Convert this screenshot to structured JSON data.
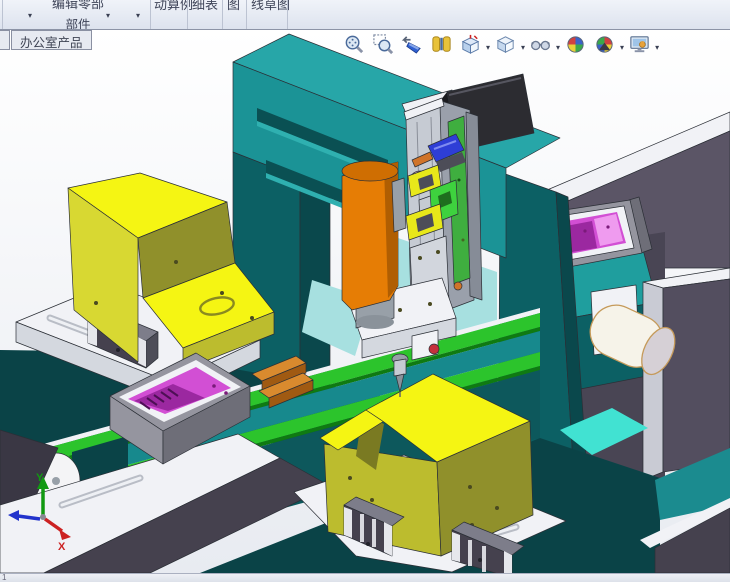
{
  "window": {
    "status_bar_left": "1"
  },
  "command_manager": {
    "component_button": {
      "top_line_clipped": "编辑零部",
      "bottom_line": "部件"
    },
    "clipped_labels": [
      "动算例",
      "细表",
      "图",
      "线草图"
    ],
    "tabs": {
      "active": "办公室产品"
    }
  },
  "heads_up_toolbar": {
    "tools": [
      {
        "name": "zoom-to-fit"
      },
      {
        "name": "zoom-to-area"
      },
      {
        "name": "previous-view"
      },
      {
        "name": "section-view"
      },
      {
        "name": "view-orientation"
      },
      {
        "name": "display-style"
      },
      {
        "name": "hide-show-items"
      },
      {
        "name": "edit-appearance"
      },
      {
        "name": "apply-scene"
      },
      {
        "name": "view-settings"
      }
    ]
  },
  "icons": {
    "caret": "▾"
  },
  "triad": {
    "x": "X",
    "y": "Y"
  },
  "scene": {
    "description": "SolidWorks assembly viewport showing an automated dispensing machine",
    "parts": [
      "gantry frame",
      "z-axis linear stage",
      "stepper motor",
      "dispenser barrel",
      "dispensing needle",
      "belt conveyor",
      "conveyor pallet with workpiece",
      "left fixture block",
      "right fixture block",
      "output tray with workpiece",
      "side roller cylinder",
      "base plates",
      "linear guide blocks",
      "reference triad"
    ]
  },
  "colors": {
    "bg_top": "#ffffff",
    "bg_bottom": "#e8ebf1",
    "white_part": "#f1f2f6",
    "gray_part": "#c9cbd4",
    "plate_front": "#d4d8df",
    "bench_face": "#5b5566",
    "bench_face2": "#534e5f",
    "bench_gap": "#494554",
    "slate": "#45414e",
    "slate_dark": "#3a3744",
    "slate_top": "#7d7d8a",
    "slate_cap": "#e6e7ec",
    "detail_dark": "#4d4d58",
    "teal_top": "#27a6a8",
    "teal_front": "#1b9396",
    "teal_slot": "#0a5053",
    "teal_slot_lip": "#2fb0b0",
    "teal_col": "#0c6064",
    "teal_col_dark": "#0a484c",
    "teal_top2": "#1f9e9e",
    "conveyor_mid": "#17898d",
    "conveyor_face": "#0d585c",
    "teal_deep": "#0a4347",
    "teal_band": "#1d8f92",
    "teal_mid2": "#1b8b8f",
    "cyan_floor": "#a7e0e0",
    "cyan_bright": "#41e2d2",
    "green_belt": "#2cc42c",
    "green_dark": "#0f7a12",
    "green_pcb": "#3fae3f",
    "green_bright": "#3ed23e",
    "green_deep": "#1e6e1e",
    "yellow_top": "#f5f513",
    "yellow_left": "#d8d832",
    "yellow_olive": "#90902b",
    "yellow_front": "#bcbc2e",
    "yellow_shadow": "#7a7a22",
    "magenta": "#d24fd4",
    "magenta_dark": "#9b28a0",
    "magenta_light": "#ef9bef",
    "magenta_dot": "#7a1a7a",
    "orange_top": "#d98a2e",
    "orange_front": "#a05a12",
    "orange_pin": "#d0742a",
    "barrel": "#e67d05",
    "barrel_dark": "#b05e02",
    "barrel_cap": "#cf6e02",
    "gray_cap": "#98a0a8",
    "gray_cap_dark": "#8a929a",
    "motor": "#2c2c31",
    "motor_dark": "#1b1b1f",
    "stage_light": "#c6cbd3",
    "stage_light2": "#d2d6dd",
    "stage_mid": "#9aa0ab",
    "stage_mid2": "#868c97",
    "clamp_yellow": "#e8e81a",
    "blue_part": "#2e3ed6",
    "pink_part": "#e7abcf",
    "pink_dark": "#c77fae",
    "red_knob": "#c4303c",
    "tray_gray": "#95959f",
    "tray_side": "#6e6e78",
    "roller_white": "#f4f4f6",
    "cyl_body": "#f6f3e9",
    "cyl_cap": "#d6d0d6",
    "bolt": "#4a4a20",
    "triad_x": "#cc2222",
    "triad_y": "#119911",
    "triad_z": "#2233cc"
  }
}
